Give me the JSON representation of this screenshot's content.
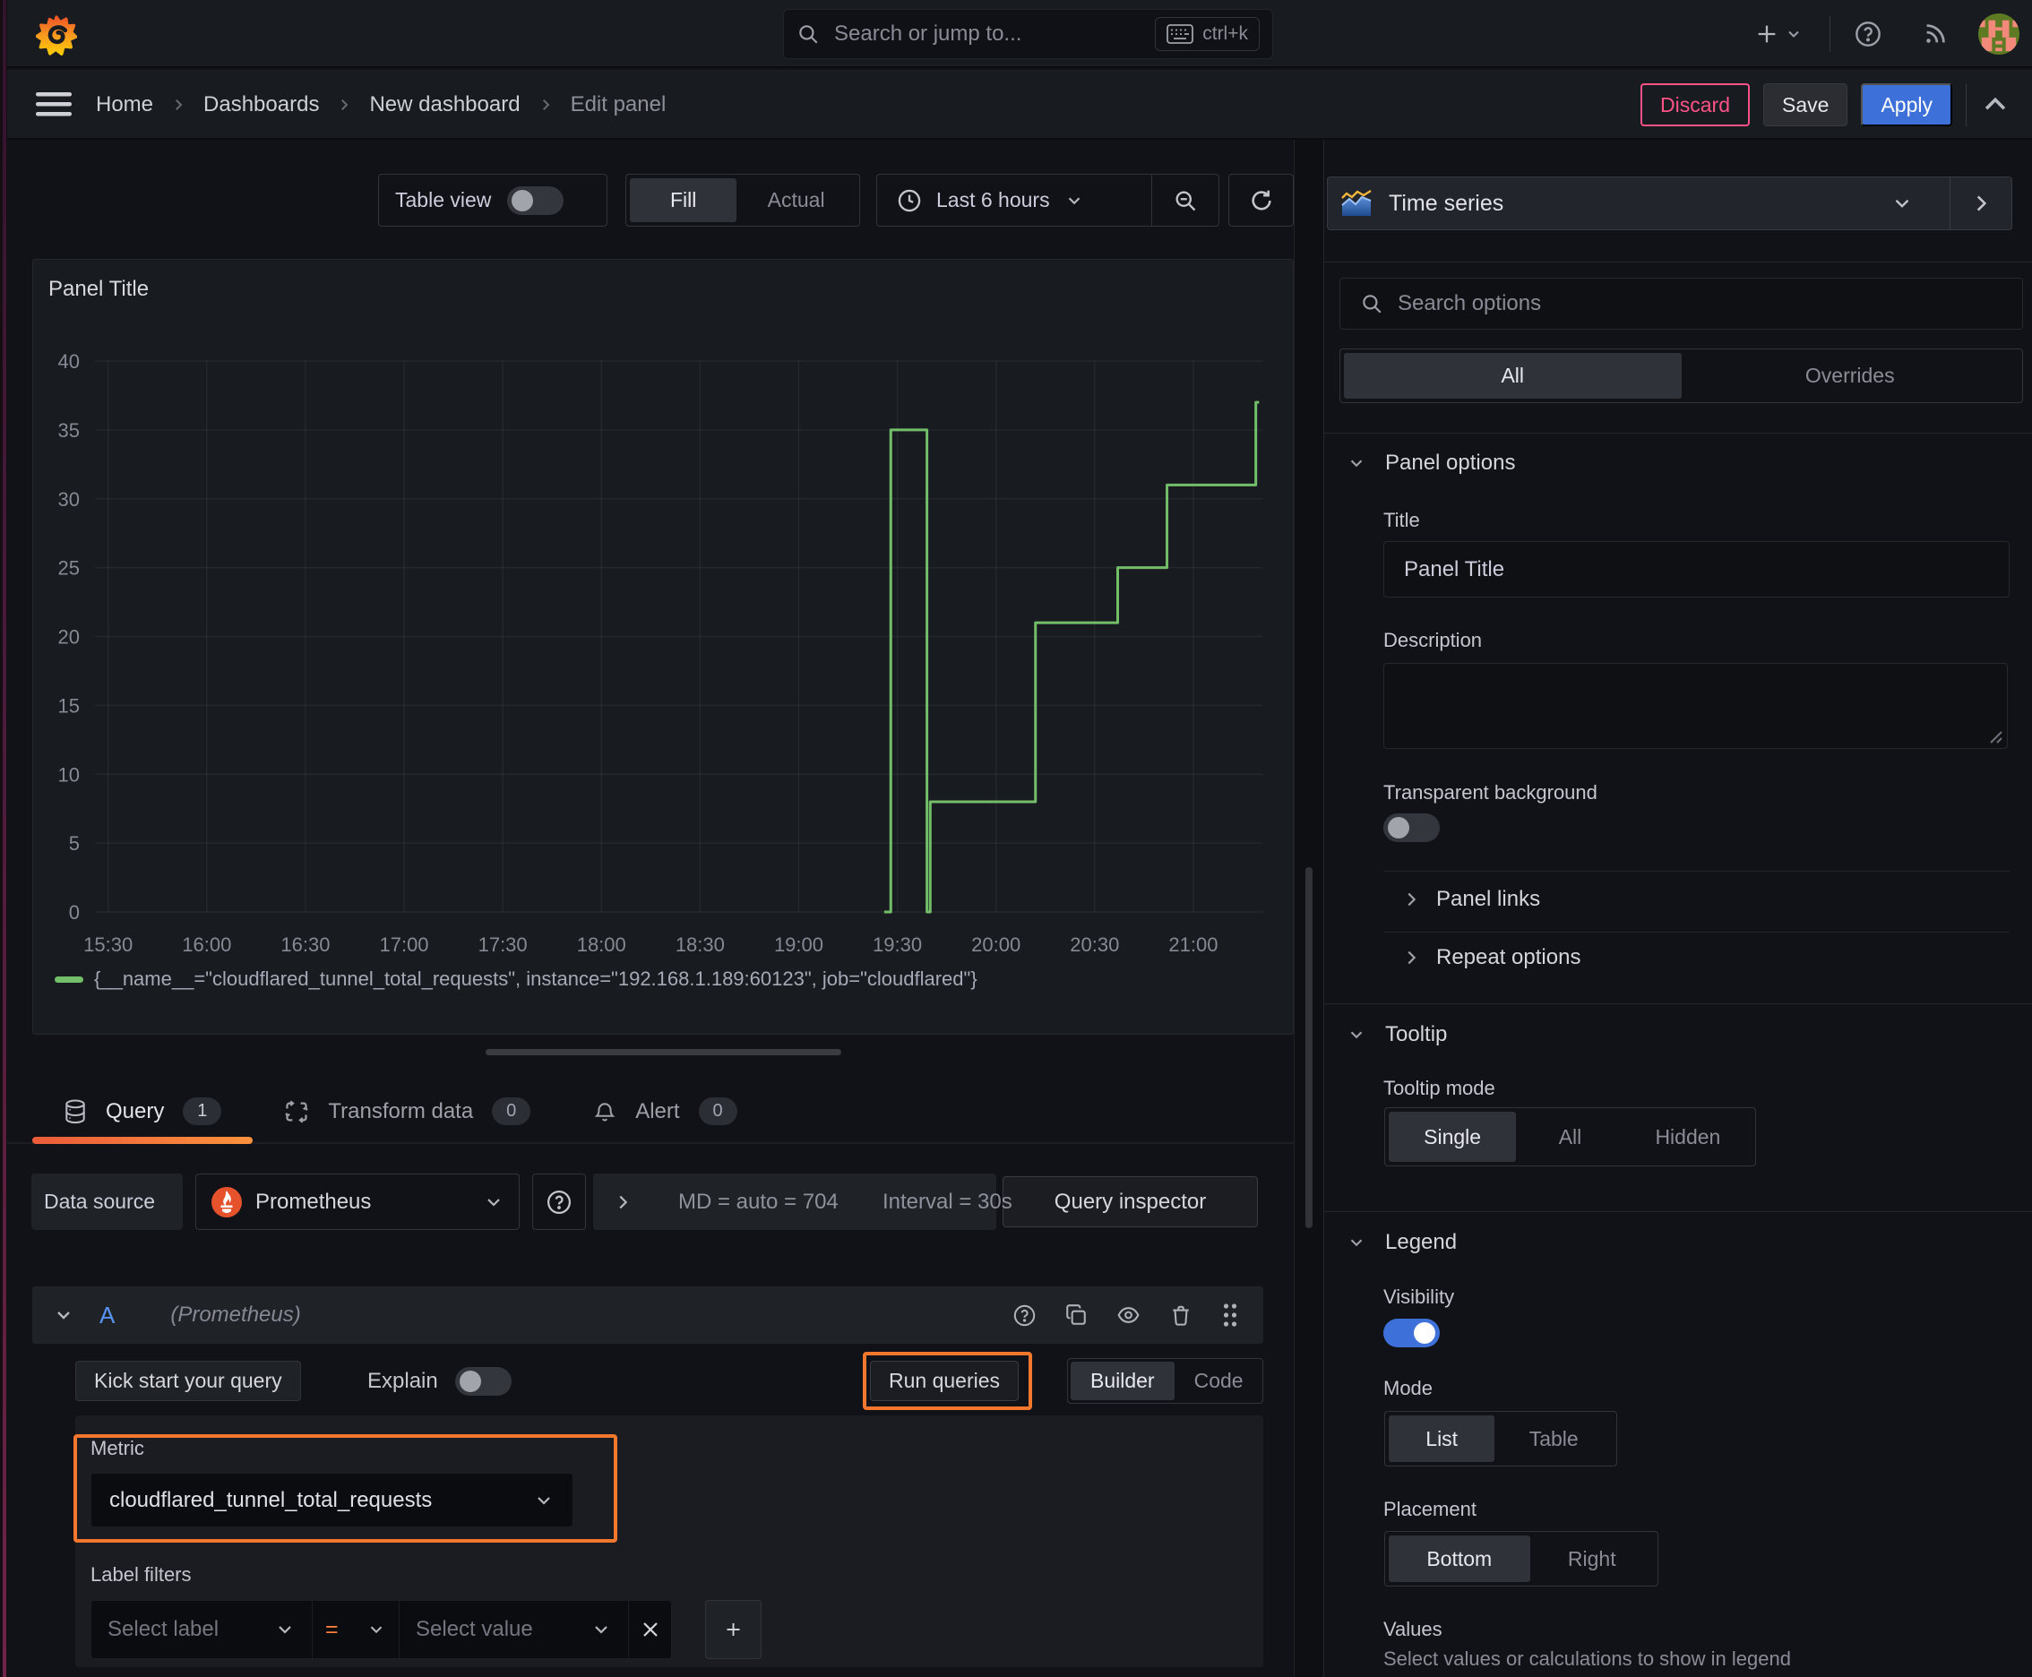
{
  "topbar": {
    "search_placeholder": "Search or jump to...",
    "search_shortcut": "ctrl+k"
  },
  "breadcrumb": {
    "items": [
      {
        "label": "Home"
      },
      {
        "label": "Dashboards"
      },
      {
        "label": "New dashboard"
      },
      {
        "label": "Edit panel"
      }
    ]
  },
  "actions": {
    "discard": "Discard",
    "save": "Save",
    "apply": "Apply"
  },
  "toolbar": {
    "table_view_label": "Table view",
    "fill_label": "Fill",
    "actual_label": "Actual",
    "time_range": "Last 6 hours"
  },
  "panel": {
    "title": "Panel Title"
  },
  "chart_data": {
    "type": "line",
    "step": true,
    "title": "Panel Title",
    "xlabel": "",
    "ylabel": "",
    "x_domain": [
      "15:26",
      "21:21"
    ],
    "x_end": "21:20",
    "x_ticks": [
      "15:30",
      "16:00",
      "16:30",
      "17:00",
      "17:30",
      "18:00",
      "18:30",
      "19:00",
      "19:30",
      "20:00",
      "20:30",
      "21:00"
    ],
    "ylim": [
      0,
      40
    ],
    "y_ticks": [
      0,
      5,
      10,
      15,
      20,
      25,
      30,
      35,
      40
    ],
    "grid": true,
    "legend_position": "bottom",
    "series": [
      {
        "name": "{__name__=\"cloudflared_tunnel_total_requests\", instance=\"192.168.1.189:60123\", job=\"cloudflared\"}",
        "color": "#73BF69",
        "points": [
          [
            "19:26",
            0
          ],
          [
            "19:28",
            35
          ],
          [
            "19:39",
            0
          ],
          [
            "19:40",
            8
          ],
          [
            "20:12",
            21
          ],
          [
            "20:37",
            25
          ],
          [
            "20:52",
            31
          ],
          [
            "21:19",
            37
          ]
        ]
      }
    ]
  },
  "tabs": {
    "query": {
      "label": "Query",
      "count": "1"
    },
    "transform": {
      "label": "Transform data",
      "count": "0"
    },
    "alert": {
      "label": "Alert",
      "count": "0"
    }
  },
  "datasource_row": {
    "label": "Data source",
    "value": "Prometheus",
    "stats_md": "MD = auto = 704",
    "stats_interval": "Interval = 30s",
    "inspector": "Query inspector"
  },
  "query_row": {
    "ref_id": "A",
    "ds_hint": "(Prometheus)",
    "kick_start": "Kick start your query",
    "explain": "Explain",
    "run_queries": "Run queries",
    "builder": "Builder",
    "code": "Code",
    "metric_label": "Metric",
    "metric_value": "cloudflared_tunnel_total_requests",
    "label_filters_label": "Label filters",
    "select_label_placeholder": "Select label",
    "operator": "=",
    "select_value_placeholder": "Select value"
  },
  "options": {
    "viz_name": "Time series",
    "search_placeholder": "Search options",
    "tab_all": "All",
    "tab_overrides": "Overrides",
    "panel_options": {
      "title": "Panel options",
      "title_label": "Title",
      "title_value": "Panel Title",
      "description_label": "Description",
      "transparent_label": "Transparent background",
      "links": "Panel links",
      "repeat": "Repeat options"
    },
    "tooltip": {
      "title": "Tooltip",
      "mode_label": "Tooltip mode",
      "modes": [
        "Single",
        "All",
        "Hidden"
      ]
    },
    "legend": {
      "title": "Legend",
      "visibility_label": "Visibility",
      "mode_label": "Mode",
      "modes": [
        "List",
        "Table"
      ],
      "placement_label": "Placement",
      "placements": [
        "Bottom",
        "Right"
      ],
      "values_label": "Values",
      "values_desc": "Select values or calculations to show in legend"
    }
  },
  "colors": {
    "canvas": "#111217",
    "surface": "#181B1F",
    "accent_orange": "#F4772E",
    "series_green": "#73BF69",
    "primary_blue": "#3D71D9",
    "destructive_pink": "#FF5286",
    "ref_id_blue": "#5794F2",
    "tab_underline_from": "#EC5B3A",
    "tab_underline_to": "#FB923C"
  }
}
